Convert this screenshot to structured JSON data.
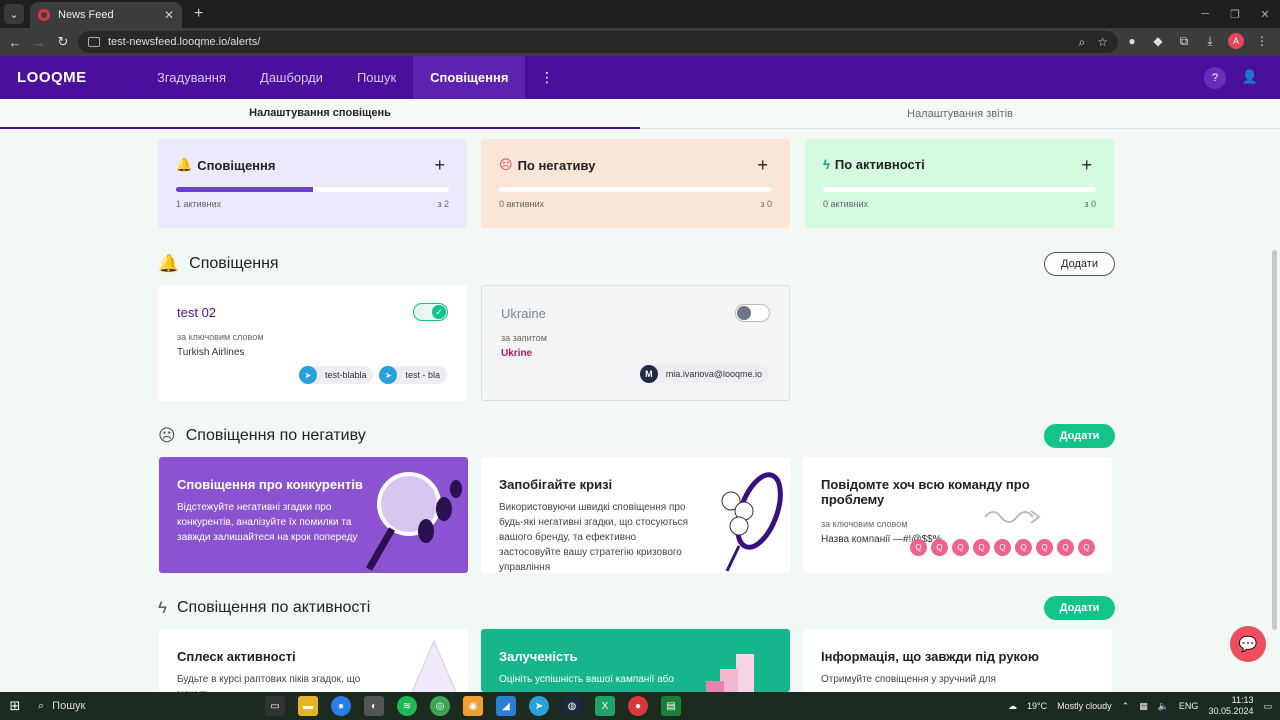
{
  "browser": {
    "tab_title": "News Feed",
    "url": "test-newsfeed.looqme.io/alerts/"
  },
  "app": {
    "logo": "LOOQME",
    "nav": [
      "Згадування",
      "Дашборди",
      "Пошук",
      "Сповіщення"
    ],
    "active_nav": "Сповіщення"
  },
  "subtabs": {
    "alerts_settings": "Налаштування сповіщень",
    "reports_settings": "Налаштування звітів"
  },
  "summary": [
    {
      "title": "Сповіщення",
      "icon": "bell-icon",
      "active_label": "1 активних",
      "of_label": "з 2",
      "progress": 0.5,
      "bg": "#ece9fb"
    },
    {
      "title": "По негативу",
      "icon": "sad-face-icon",
      "active_label": "0 активних",
      "of_label": "з 0",
      "progress": 0,
      "bg": "#fbe5d6"
    },
    {
      "title": "По активності",
      "icon": "lightning-icon",
      "active_label": "0 активних",
      "of_label": "з 0",
      "progress": 0,
      "bg": "#d4fbe0"
    }
  ],
  "alerts_section": {
    "title": "Сповіщення",
    "add_label": "Додати",
    "cards": [
      {
        "name": "test 02",
        "type_label": "за ключовим словом",
        "keyword": "Turkish Airlines",
        "enabled": true,
        "chips": [
          "test-blabla",
          "test - bla"
        ]
      },
      {
        "name": "Ukraine",
        "type_label": "за запитом",
        "keyword": "Ukrine",
        "enabled": false,
        "recipient": "mia.ivanova@looqme.io",
        "recipient_initial": "M"
      }
    ]
  },
  "negative_section": {
    "title": "Сповіщення по негативу",
    "add_label": "Додати",
    "cards": [
      {
        "title": "Сповіщення про конкурентів",
        "desc": "Відстежуйте негативні згадки про конкурентів, аналізуйте їх помилки та завжди залишайтеся на крок попереду"
      },
      {
        "title": "Запобігайте кризі",
        "desc": "Використовуючи швидкі сповіщення про будь-які негативні згадки, що стосуються вашого бренду, та ефективно застосовуйте вашу стратегію кризового управління"
      },
      {
        "title": "Повідомте хоч всю команду про проблему",
        "small": "за ключовим словом",
        "keyword": "Назва компанії —#!@$$%"
      }
    ]
  },
  "activity_section": {
    "title": "Сповіщення по активності",
    "add_label": "Додати",
    "cards": [
      {
        "title": "Сплеск активності",
        "desc": "Будьте в курсі раптових піків згадок, що можуть"
      },
      {
        "title": "Залученість",
        "desc": "Оцініть успішність вашої кампанії або"
      },
      {
        "title": "Інформація, що завжди під рукою",
        "desc": "Отримуйте сповіщення у зручний для"
      }
    ]
  },
  "taskbar": {
    "search": "Пошук",
    "weather": "19°C",
    "weather_text": "Mostly cloudy",
    "lang": "ENG",
    "time": "11:13",
    "date": "30.05.2024"
  },
  "colors": {
    "header": "#4a0f9b",
    "green": "#12c38a",
    "purple_card": "#8b52d1"
  }
}
